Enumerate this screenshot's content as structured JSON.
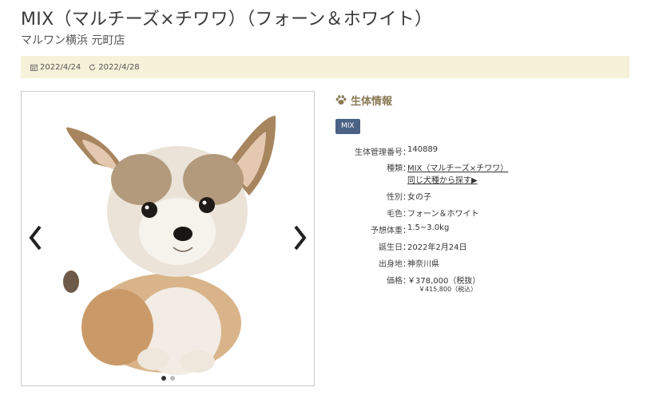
{
  "header": {
    "title": "MIX（マルチーズ×チワワ）（フォーン＆ホワイト）",
    "store": "マルワン横浜 元町店"
  },
  "dates": {
    "posted": "2022/4/24",
    "updated": "2022/4/28"
  },
  "gallery": {
    "slide_count": 2,
    "active_index": 0
  },
  "info": {
    "heading": "生体情報",
    "badge": "MIX",
    "rows": {
      "id": {
        "label": "生体管理番号",
        "value": "140889"
      },
      "breed": {
        "label": "種類",
        "value": "MIX（マルチーズ×チワワ）",
        "link": "同じ犬種から探す▶"
      },
      "sex": {
        "label": "性別",
        "value": "女の子"
      },
      "color": {
        "label": "毛色",
        "value": "フォーン＆ホワイト"
      },
      "weight": {
        "label": "予想体重",
        "value": "1.5~3.0kg"
      },
      "birthday": {
        "label": "誕生日",
        "value": "2022年2月24日"
      },
      "origin": {
        "label": "出身地",
        "value": "神奈川県"
      },
      "price": {
        "label": "価格",
        "value": "￥378,000（税抜）",
        "tax_included": "￥415,800（税込）"
      }
    }
  },
  "colors": {
    "date_bar": "#f6f1d9",
    "badge": "#4a6283",
    "heading": "#8a7a55"
  },
  "icons": {
    "posted": "calendar-icon",
    "updated": "refresh-icon",
    "heading": "paw-icon"
  }
}
